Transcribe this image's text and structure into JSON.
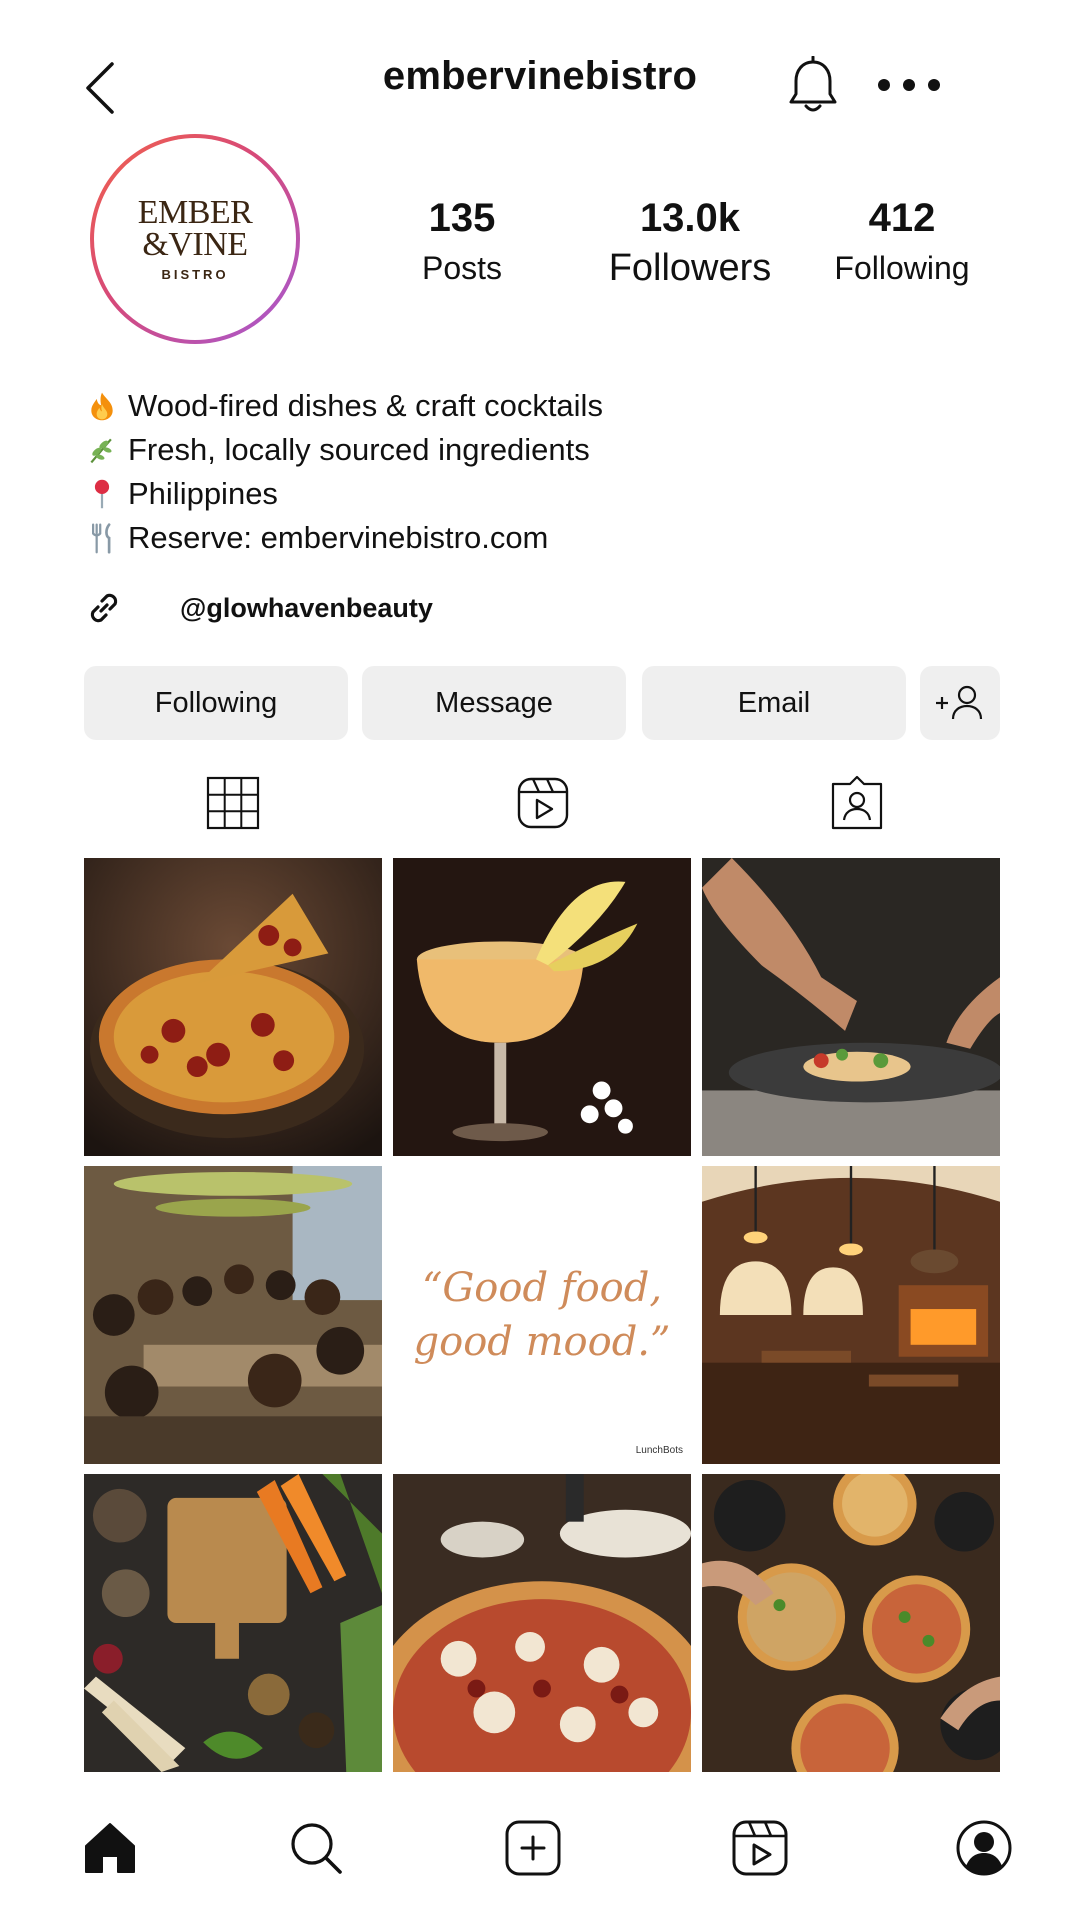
{
  "header": {
    "username": "embervinebistro"
  },
  "profile": {
    "logo": {
      "line1": "EMBER",
      "line2": "&VINE",
      "line3": "BISTRO"
    },
    "stats": [
      {
        "value": "135",
        "label": "Posts"
      },
      {
        "value": "13.0k",
        "label": "Followers"
      },
      {
        "value": "412",
        "label": "Following"
      }
    ],
    "bio": [
      {
        "icon": "fire-emoji",
        "text": "Wood-fired dishes & craft cocktails"
      },
      {
        "icon": "herb-emoji",
        "text": "Fresh, locally sourced ingredients"
      },
      {
        "icon": "pin-emoji",
        "text": "Philippines"
      },
      {
        "icon": "fork-knife-emoji",
        "text": "Reserve: embervinebistro.com"
      }
    ],
    "link": {
      "icon": "link-icon",
      "text": "@glowhavenbeauty"
    }
  },
  "actions": {
    "following_label": "Following",
    "message_label": "Message",
    "email_label": "Email"
  },
  "tabs": [
    {
      "icon": "grid-icon"
    },
    {
      "icon": "reels-icon"
    },
    {
      "icon": "tagged-icon"
    }
  ],
  "posts": [
    {
      "subject": "pepperoni-pizza"
    },
    {
      "subject": "cocktail"
    },
    {
      "subject": "chef-plating"
    },
    {
      "subject": "dining-crowd"
    },
    {
      "subject": "quote-card",
      "quote_line1": "“Good food,",
      "quote_line2": "good mood.”",
      "watermark": "LunchBots"
    },
    {
      "subject": "restaurant-interior"
    },
    {
      "subject": "vegetables-flatlay"
    },
    {
      "subject": "pizza-closeup"
    },
    {
      "subject": "pizza-table"
    }
  ],
  "bottom_nav": [
    {
      "icon": "home-icon"
    },
    {
      "icon": "search-icon"
    },
    {
      "icon": "create-icon"
    },
    {
      "icon": "reels-icon"
    },
    {
      "icon": "profile-icon"
    }
  ],
  "colors": {
    "button_bg": "#efefef",
    "ring_start": "#f2624a",
    "ring_end": "#a45ad6",
    "logo_brown": "#3b2613"
  }
}
